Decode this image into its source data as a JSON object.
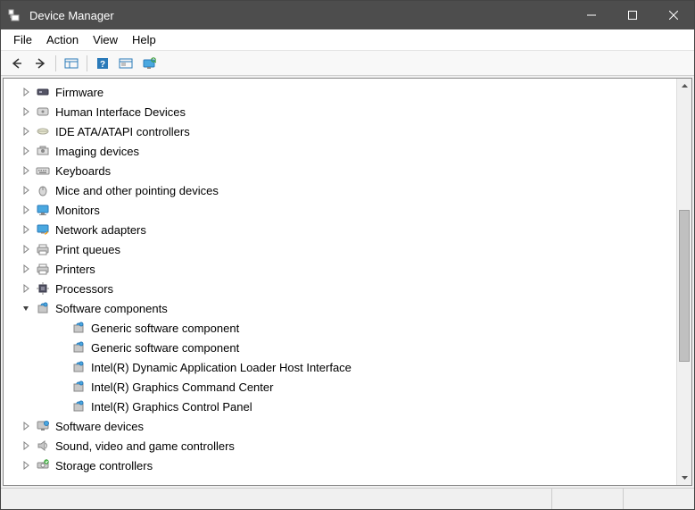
{
  "window": {
    "title": "Device Manager"
  },
  "menus": {
    "file": "File",
    "action": "Action",
    "view": "View",
    "help": "Help"
  },
  "tree": {
    "items": [
      {
        "label": "Firmware",
        "expanded": false,
        "icon": "firmware"
      },
      {
        "label": "Human Interface Devices",
        "expanded": false,
        "icon": "hid"
      },
      {
        "label": "IDE ATA/ATAPI controllers",
        "expanded": false,
        "icon": "ide"
      },
      {
        "label": "Imaging devices",
        "expanded": false,
        "icon": "imaging"
      },
      {
        "label": "Keyboards",
        "expanded": false,
        "icon": "keyboard"
      },
      {
        "label": "Mice and other pointing devices",
        "expanded": false,
        "icon": "mouse"
      },
      {
        "label": "Monitors",
        "expanded": false,
        "icon": "monitor"
      },
      {
        "label": "Network adapters",
        "expanded": false,
        "icon": "network"
      },
      {
        "label": "Print queues",
        "expanded": false,
        "icon": "printer"
      },
      {
        "label": "Printers",
        "expanded": false,
        "icon": "printer"
      },
      {
        "label": "Processors",
        "expanded": false,
        "icon": "processor"
      },
      {
        "label": "Software components",
        "expanded": true,
        "icon": "component",
        "children": [
          {
            "label": "Generic software component",
            "icon": "component"
          },
          {
            "label": "Generic software component",
            "icon": "component"
          },
          {
            "label": "Intel(R) Dynamic Application Loader Host Interface",
            "icon": "component"
          },
          {
            "label": "Intel(R) Graphics Command Center",
            "icon": "component"
          },
          {
            "label": "Intel(R) Graphics Control Panel",
            "icon": "component"
          }
        ]
      },
      {
        "label": "Software devices",
        "expanded": false,
        "icon": "softdev"
      },
      {
        "label": "Sound, video and game controllers",
        "expanded": false,
        "icon": "sound"
      },
      {
        "label": "Storage controllers",
        "expanded": false,
        "icon": "storage"
      }
    ]
  }
}
